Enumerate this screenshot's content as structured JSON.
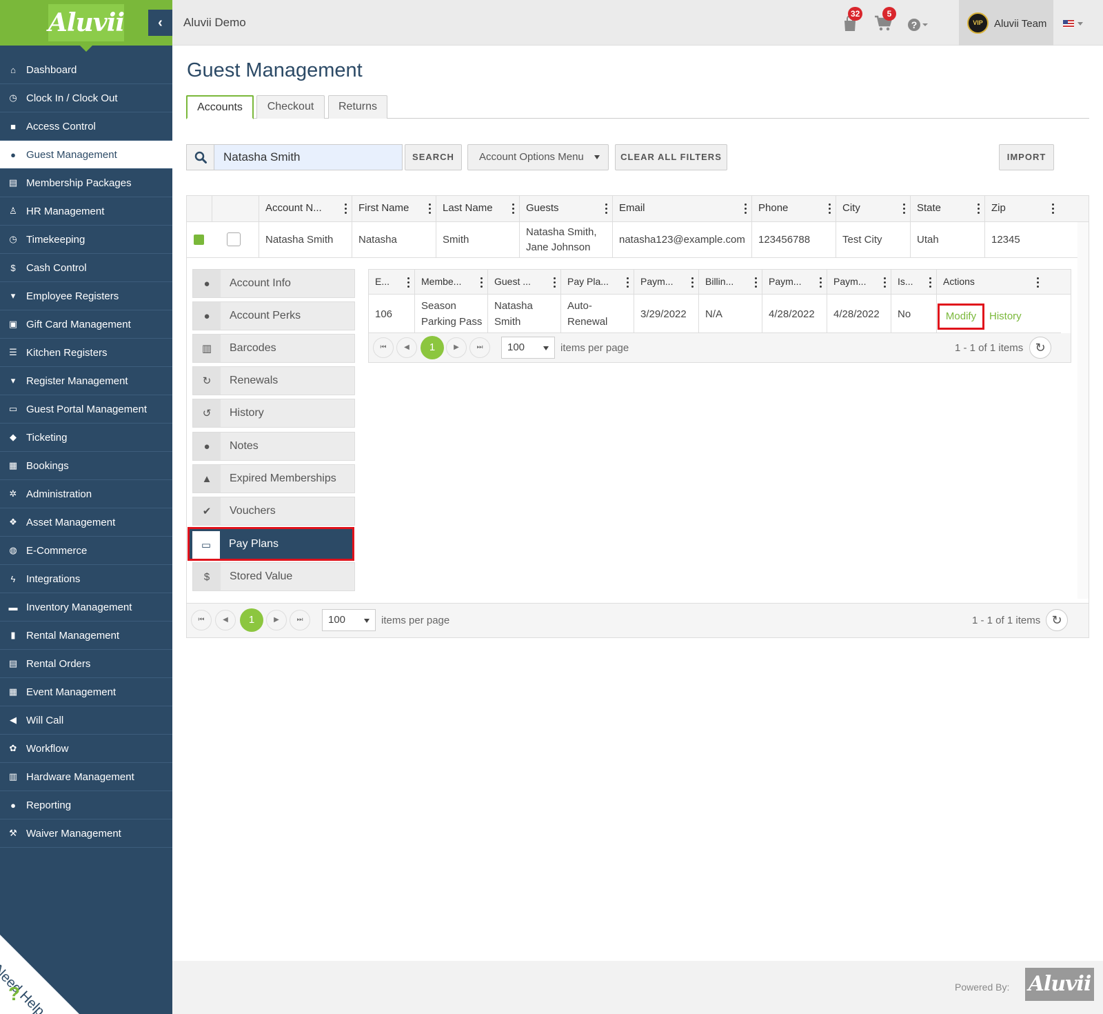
{
  "app": {
    "logo_text": "Aluvii",
    "title": "Aluvii Demo"
  },
  "topbar": {
    "notifications_count": "32",
    "cart_count": "5",
    "user_name": "Aluvii Team",
    "avatar_text": "VIP"
  },
  "sidebar": {
    "items": [
      {
        "label": "Dashboard",
        "icon": "home-icon"
      },
      {
        "label": "Clock In / Clock Out",
        "icon": "clock-icon"
      },
      {
        "label": "Access Control",
        "icon": "lock-icon"
      },
      {
        "label": "Guest Management",
        "icon": "users-icon"
      },
      {
        "label": "Membership Packages",
        "icon": "id-card-icon"
      },
      {
        "label": "HR Management",
        "icon": "hr-icon"
      },
      {
        "label": "Timekeeping",
        "icon": "clock-icon"
      },
      {
        "label": "Cash Control",
        "icon": "dollar-icon"
      },
      {
        "label": "Employee Registers",
        "icon": "cart-icon"
      },
      {
        "label": "Gift Card Management",
        "icon": "gift-icon"
      },
      {
        "label": "Kitchen Registers",
        "icon": "list-icon"
      },
      {
        "label": "Register Management",
        "icon": "cart-icon"
      },
      {
        "label": "Guest Portal Management",
        "icon": "laptop-icon"
      },
      {
        "label": "Ticketing",
        "icon": "ticket-icon"
      },
      {
        "label": "Bookings",
        "icon": "calendar-icon"
      },
      {
        "label": "Administration",
        "icon": "cogs-icon"
      },
      {
        "label": "Asset Management",
        "icon": "cubes-icon"
      },
      {
        "label": "E-Commerce",
        "icon": "globe-icon"
      },
      {
        "label": "Integrations",
        "icon": "bolt-icon"
      },
      {
        "label": "Inventory Management",
        "icon": "archive-icon"
      },
      {
        "label": "Rental Management",
        "icon": "clipboard-icon"
      },
      {
        "label": "Rental Orders",
        "icon": "document-icon"
      },
      {
        "label": "Event Management",
        "icon": "calendar-check-icon"
      },
      {
        "label": "Will Call",
        "icon": "megaphone-icon"
      },
      {
        "label": "Workflow",
        "icon": "gear-icon"
      },
      {
        "label": "Hardware Management",
        "icon": "printer-icon"
      },
      {
        "label": "Reporting",
        "icon": "lightbulb-icon"
      },
      {
        "label": "Waiver Management",
        "icon": "gavel-icon"
      }
    ],
    "active_index": 3
  },
  "page": {
    "title": "Guest Management",
    "tabs": [
      "Accounts",
      "Checkout",
      "Returns"
    ],
    "active_tab": 0
  },
  "search": {
    "value": "Natasha Smith",
    "search_label": "SEARCH",
    "options_menu_label": "Account Options Menu",
    "clear_label": "CLEAR ALL FILTERS",
    "import_label": "IMPORT"
  },
  "accounts_grid": {
    "columns": [
      "Account N...",
      "First Name",
      "Last Name",
      "Guests",
      "Email",
      "Phone",
      "City",
      "State",
      "Zip"
    ],
    "rows": [
      {
        "account_name": "Natasha Smith",
        "first_name": "Natasha",
        "last_name": "Smith",
        "guests_line1": "Natasha Smith,",
        "guests_line2": "Jane Johnson",
        "email": "natasha123@example.com",
        "phone": "123456788",
        "city": "Test City",
        "state": "Utah",
        "zip": "12345"
      }
    ],
    "pager": {
      "current_page": "1",
      "page_size": "100",
      "items_per_page_label": "items per page",
      "summary": "1 - 1 of 1 items"
    }
  },
  "detail_menu": {
    "items": [
      {
        "label": "Account Info",
        "icon": "users-icon"
      },
      {
        "label": "Account Perks",
        "icon": "users-icon"
      },
      {
        "label": "Barcodes",
        "icon": "barcode-icon"
      },
      {
        "label": "Renewals",
        "icon": "refresh-icon"
      },
      {
        "label": "History",
        "icon": "history-icon"
      },
      {
        "label": "Notes",
        "icon": "comments-icon"
      },
      {
        "label": "Expired Memberships",
        "icon": "warning-icon"
      },
      {
        "label": "Vouchers",
        "icon": "check-icon"
      },
      {
        "label": "Pay Plans",
        "icon": "credit-card-icon"
      },
      {
        "label": "Stored Value",
        "icon": "dollar-icon"
      }
    ],
    "active_index": 8
  },
  "pay_plans_grid": {
    "columns": [
      "E...",
      "Membe...",
      "Guest ...",
      "Pay Pla...",
      "Paym...",
      "Billin...",
      "Paym...",
      "Paym...",
      "Is...",
      "Actions"
    ],
    "rows": [
      {
        "e": "106",
        "membership_line1": "Season",
        "membership_line2": "Parking Pass",
        "guest_line1": "Natasha",
        "guest_line2": "Smith",
        "pay_plan_line1": "Auto-",
        "pay_plan_line2": "Renewal",
        "payment_date": "3/29/2022",
        "billing": "N/A",
        "payment2": "4/28/2022",
        "payment3": "4/28/2022",
        "is": "No",
        "modify_label": "Modify",
        "history_label": "History"
      }
    ],
    "pager": {
      "current_page": "1",
      "page_size": "100",
      "items_per_page_label": "items per page",
      "summary": "1 - 1 of 1 items"
    }
  },
  "footer": {
    "powered_by": "Powered By:",
    "logo_text": "Aluvii",
    "need_help": "Need Help"
  },
  "colors": {
    "sidebar": "#2c4a66",
    "brand_green": "#7ab83a",
    "highlight_red": "#e0121b"
  }
}
